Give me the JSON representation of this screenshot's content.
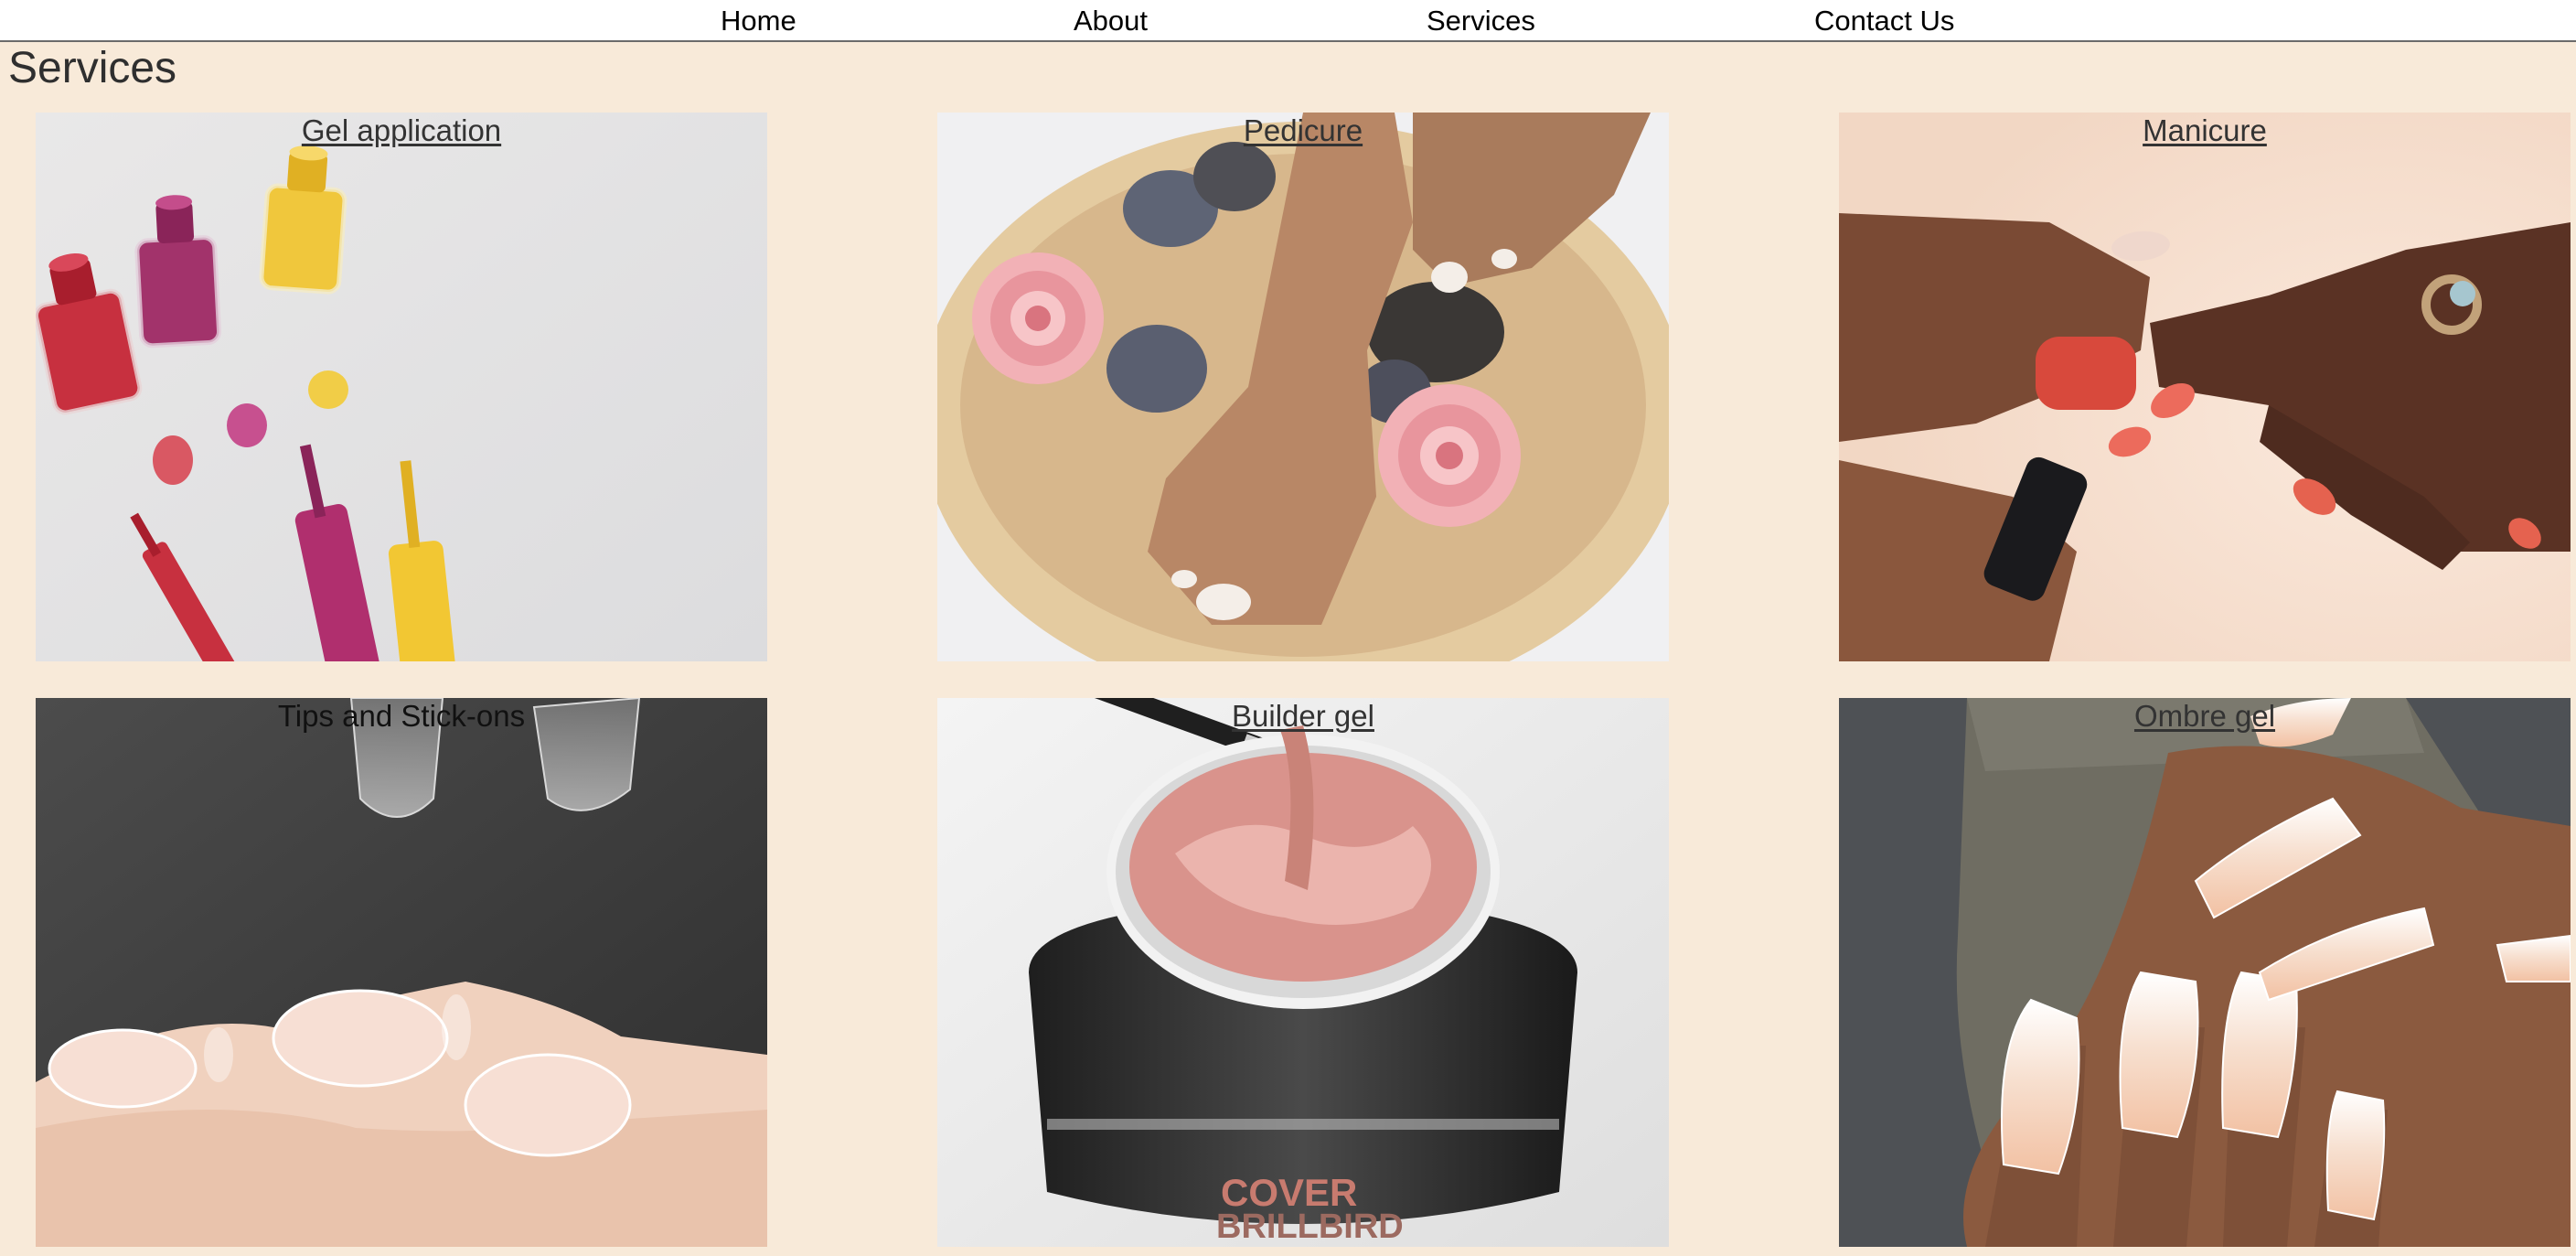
{
  "nav": {
    "home": "Home",
    "about": "About",
    "services": "Services",
    "contact": "Contact Us"
  },
  "page": {
    "title": "Services"
  },
  "services": [
    {
      "label": "Gel application",
      "image": "nail-polish-bottles-image"
    },
    {
      "label": "Pedicure",
      "image": "pedicure-foot-bowl-image"
    },
    {
      "label": "Manicure",
      "image": "manicure-painting-nails-image"
    },
    {
      "label": "Tips and Stick-ons",
      "image": "clear-nail-tips-image"
    },
    {
      "label": "Builder gel",
      "image": "builder-gel-jar-image",
      "jar_text": [
        "COVER",
        "BRILLBIRD"
      ]
    },
    {
      "label": "Ombre gel",
      "image": "ombre-nails-image"
    }
  ],
  "colors": {
    "page_background": "#f8ead9",
    "nav_background": "#ffffff",
    "nav_border": "#6b6b6b"
  }
}
